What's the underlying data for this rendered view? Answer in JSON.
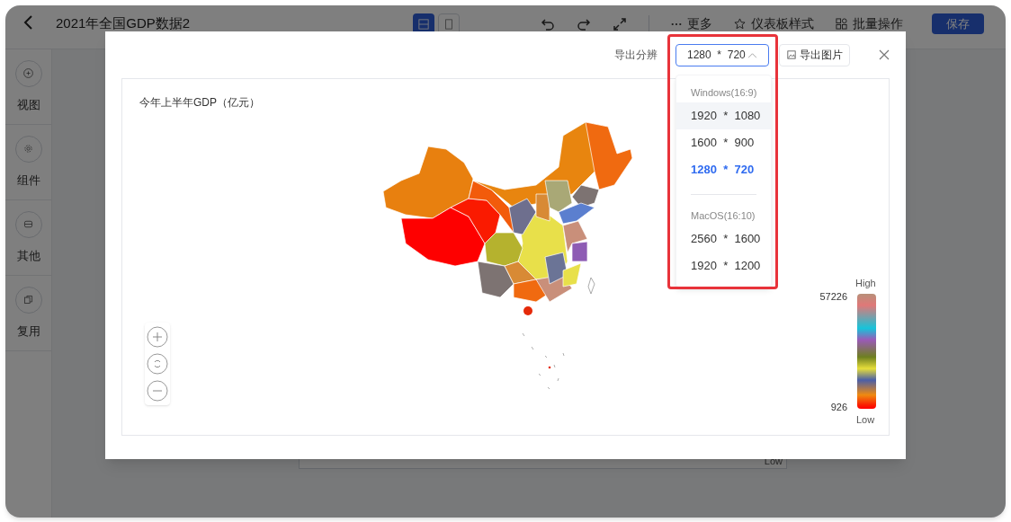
{
  "app": {
    "title": "2021年全国GDP数据2",
    "view_modes": [
      {
        "selected": true
      },
      {
        "selected": false
      }
    ],
    "toolbar": [
      {
        "kind": "more",
        "label": "更多"
      },
      {
        "kind": "style",
        "label": "仪表板样式"
      },
      {
        "kind": "batch",
        "label": "批量操作"
      }
    ],
    "save_button": "保存",
    "sidebar": [
      {
        "label": "视图",
        "kind": "add"
      },
      {
        "label": "组件",
        "kind": "gear"
      },
      {
        "label": "其他",
        "kind": "box"
      },
      {
        "label": "复用",
        "kind": "copy"
      }
    ],
    "background_card": {
      "legend_low": "Low"
    }
  },
  "export_dialog": {
    "resolution_label": "导出分辨",
    "resolution_value": "1280  *  720",
    "expanded": true,
    "export_button": "导出图片",
    "option_groups": [
      {
        "group": "Windows(16:9)",
        "options": [
          {
            "label": "1920  *  1080",
            "selected": false,
            "hovered": true
          },
          {
            "label": "1600  *  900",
            "selected": false,
            "hovered": false
          },
          {
            "label": "1280  *  720",
            "selected": true,
            "hovered": false
          }
        ]
      },
      {
        "group": "MacOS(16:10)",
        "options": [
          {
            "label": "2560  *  1600",
            "selected": false,
            "hovered": false
          },
          {
            "label": "1920  *  1200",
            "selected": false,
            "hovered": false
          }
        ]
      }
    ],
    "chart": {
      "title": "今年上半年GDP（亿元）",
      "legend": {
        "high_label": "High",
        "max": "57226",
        "min": "926",
        "low_label": "Low"
      }
    }
  }
}
